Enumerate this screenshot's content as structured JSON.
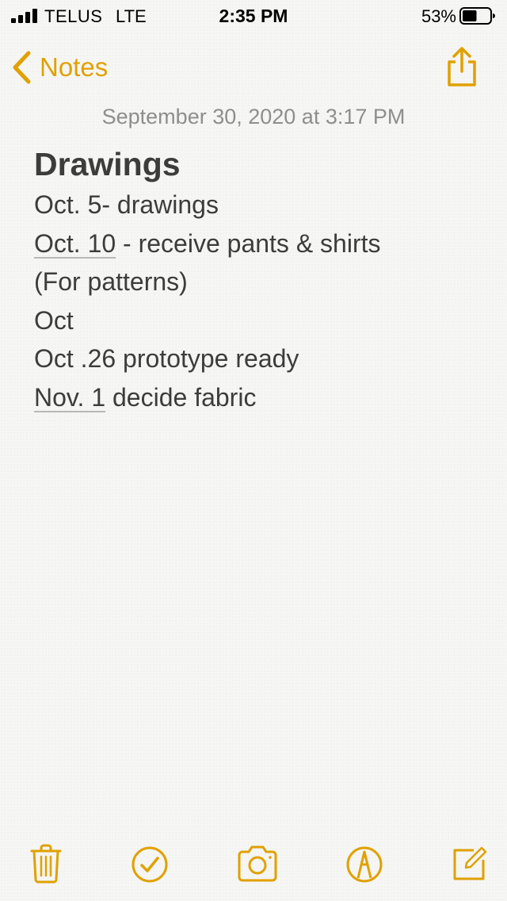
{
  "status_bar": {
    "carrier": "TELUS",
    "network": "LTE",
    "time": "2:35 PM",
    "battery_percent": "53%",
    "battery_level": 0.53,
    "signal_bars": 4
  },
  "nav": {
    "back_label": "Notes",
    "back_icon": "chevron-left-icon",
    "share_icon": "share-icon"
  },
  "note": {
    "timestamp": "September 30, 2020 at 3:17 PM",
    "title": "Drawings",
    "lines": [
      {
        "text": "Oct. 5- drawings"
      },
      {
        "link": "Oct. 10",
        "rest": " - receive pants & shirts"
      },
      {
        "text": "(For patterns)"
      },
      {
        "text": "Oct"
      },
      {
        "text": "Oct .26 prototype ready"
      },
      {
        "link": "Nov. 1",
        "rest": " decide fabric"
      }
    ]
  },
  "toolbar": {
    "icons": [
      "trash-icon",
      "checklist-icon",
      "camera-icon",
      "markup-icon",
      "compose-icon"
    ]
  },
  "colors": {
    "accent": "#e0a100",
    "text": "#3c3c3c",
    "timestamp": "#8e8e8e",
    "background": "#f6f6f4"
  }
}
